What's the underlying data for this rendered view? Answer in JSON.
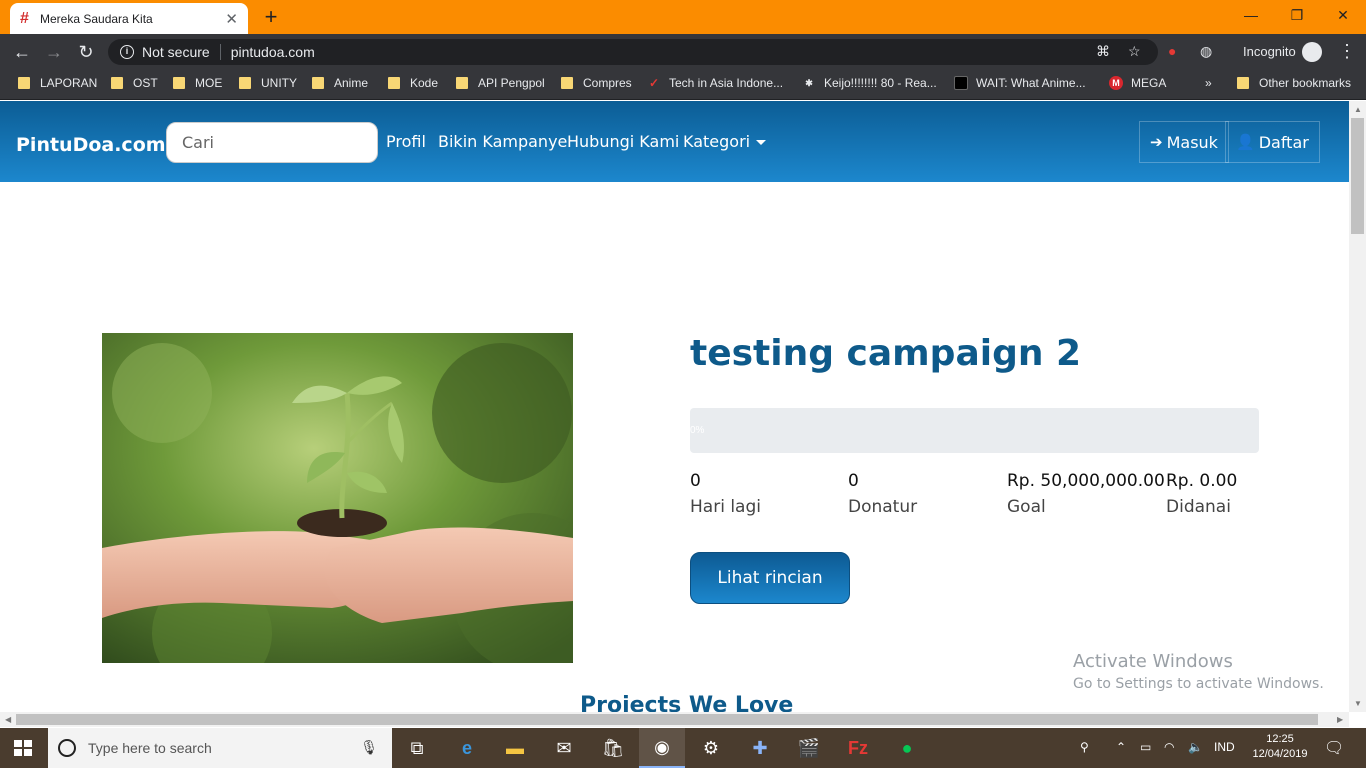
{
  "browser": {
    "tab_title": "Mereka Saudara Kita",
    "security_label": "Not secure",
    "url": "pintudoa.com",
    "incognito_label": "Incognito"
  },
  "bookmarks": [
    {
      "label": "LAPORAN",
      "icon": "folder-icon"
    },
    {
      "label": "OST",
      "icon": "folder-icon"
    },
    {
      "label": "MOE",
      "icon": "folder-icon"
    },
    {
      "label": "UNITY",
      "icon": "folder-icon"
    },
    {
      "label": "Anime",
      "icon": "folder-icon"
    },
    {
      "label": "Kode",
      "icon": "folder-icon"
    },
    {
      "label": "API Pengpol",
      "icon": "folder-icon"
    },
    {
      "label": "Compres",
      "icon": "folder-icon"
    },
    {
      "label": "Tech in Asia Indone...",
      "icon": "techinasia-icon"
    },
    {
      "label": "Keijo!!!!!!!! 80 - Rea...",
      "icon": "page-icon"
    },
    {
      "label": "WAIT: What Anime...",
      "icon": "page-icon"
    },
    {
      "label": "MEGA",
      "icon": "mega-icon"
    },
    {
      "label": "»",
      "icon": "overflow-icon"
    },
    {
      "label": "Other bookmarks",
      "icon": "folder-icon"
    }
  ],
  "site": {
    "brand": "PintuDoa.com",
    "search_placeholder": "Cari",
    "nav": [
      "Profil",
      "Bikin Kampanye",
      "Hubungi Kami",
      "Kategori"
    ],
    "login_label": "Masuk",
    "register_label": "Daftar"
  },
  "campaign": {
    "title": "testing campaign 2",
    "progress_text": "0%",
    "progress_fraction": 0,
    "stats": [
      {
        "value": "0",
        "label": "Hari lagi"
      },
      {
        "value": "0",
        "label": "Donatur"
      },
      {
        "value": "Rp. 50,000,000.00",
        "label": "Goal"
      },
      {
        "value": "Rp. 0.00",
        "label": "Didanai"
      }
    ],
    "cta_label": "Lihat rincian"
  },
  "section_title": "Projects We Love",
  "watermark": {
    "line1": "Activate Windows",
    "line2": "Go to Settings to activate Windows."
  },
  "taskbar": {
    "search_placeholder": "Type here to search",
    "language": "IND",
    "time": "12:25",
    "date": "12/04/2019"
  },
  "colors": {
    "titlebar": "#fb8c00",
    "navbar_top": "#0c5d95",
    "navbar_bottom": "#1c87cd",
    "title_text": "#0e5a8a"
  }
}
